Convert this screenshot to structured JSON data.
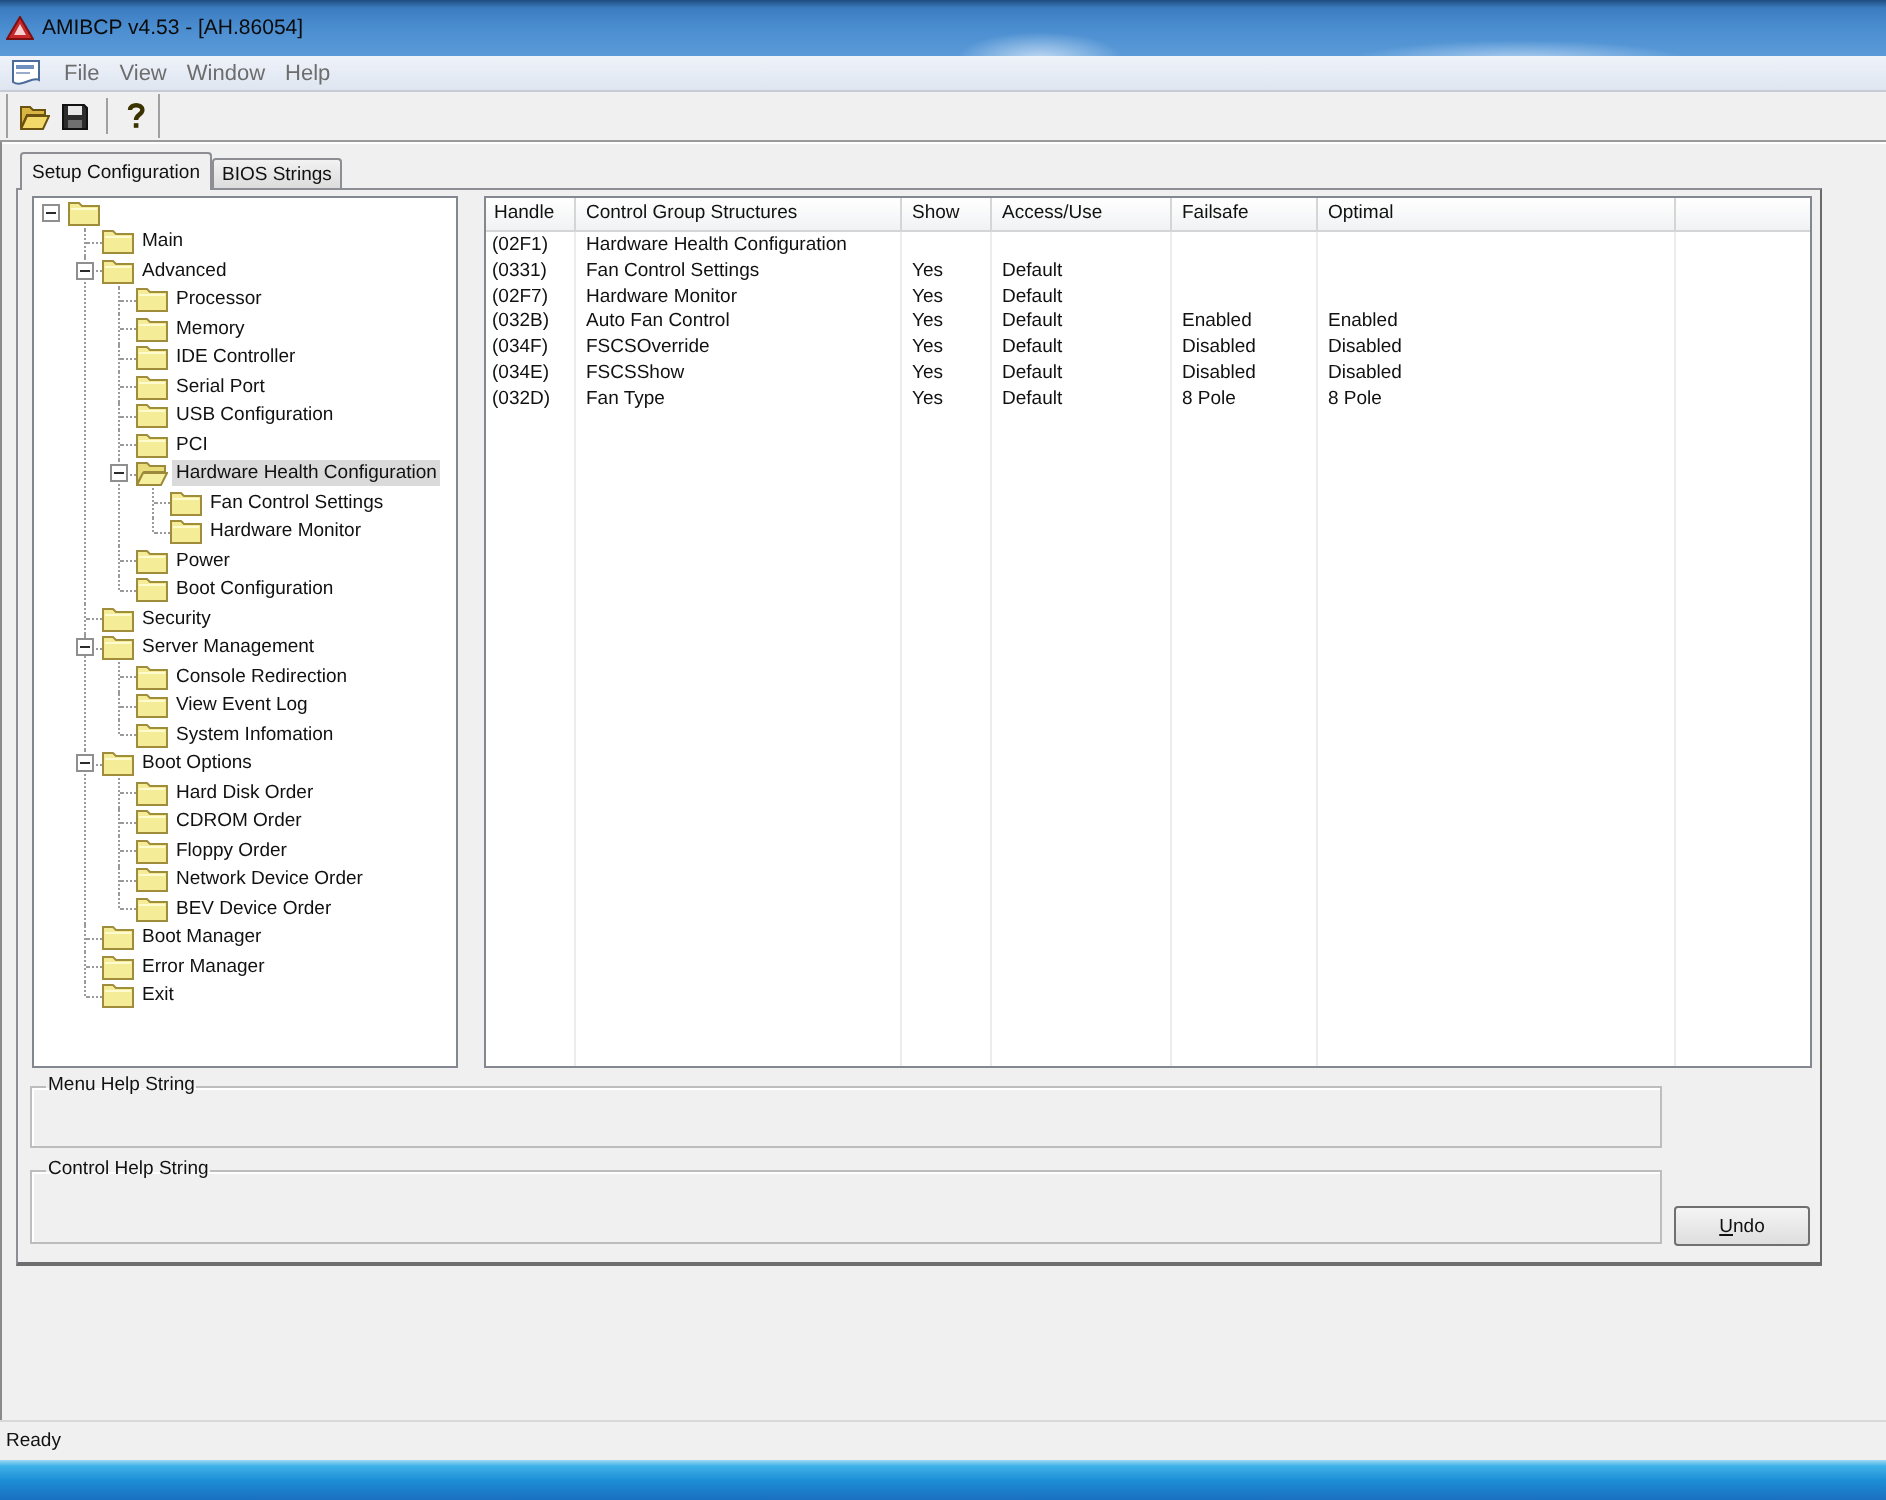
{
  "window": {
    "title": "AMIBCP v4.53 - [AH.86054]"
  },
  "menu_bar": [
    "File",
    "View",
    "Window",
    "Help"
  ],
  "tabs": [
    {
      "label": "Setup Configuration",
      "selected": true
    },
    {
      "label": "BIOS Strings",
      "selected": false
    }
  ],
  "tree": {
    "expanded": true,
    "children": [
      {
        "label": "Main",
        "selected": false
      },
      {
        "label": "Advanced",
        "selected": false,
        "expanded": true,
        "children": [
          {
            "label": "Processor",
            "selected": false
          },
          {
            "label": "Memory",
            "selected": false
          },
          {
            "label": "IDE Controller",
            "selected": false
          },
          {
            "label": "Serial Port",
            "selected": false
          },
          {
            "label": "USB Configuration",
            "selected": false
          },
          {
            "label": "PCI",
            "selected": false
          },
          {
            "label": "Hardware Health Configuration",
            "selected": true,
            "expanded": true,
            "children": [
              {
                "label": "Fan Control Settings",
                "selected": false
              },
              {
                "label": "Hardware Monitor",
                "selected": false
              }
            ]
          },
          {
            "label": "Power",
            "selected": false
          },
          {
            "label": "Boot Configuration",
            "selected": false
          }
        ]
      },
      {
        "label": "Security",
        "selected": false
      },
      {
        "label": "Server Management",
        "selected": false,
        "expanded": true,
        "children": [
          {
            "label": "Console Redirection",
            "selected": false
          },
          {
            "label": "View Event Log",
            "selected": false
          },
          {
            "label": "System Infomation",
            "selected": false
          }
        ]
      },
      {
        "label": "Boot Options",
        "selected": false,
        "expanded": true,
        "children": [
          {
            "label": "Hard Disk Order",
            "selected": false
          },
          {
            "label": "CDROM Order",
            "selected": false
          },
          {
            "label": "Floppy Order",
            "selected": false
          },
          {
            "label": "Network Device Order",
            "selected": false
          },
          {
            "label": "BEV Device Order",
            "selected": false
          }
        ]
      },
      {
        "label": "Boot Manager",
        "selected": false
      },
      {
        "label": "Error Manager",
        "selected": false
      },
      {
        "label": "Exit",
        "selected": false
      }
    ]
  },
  "table": {
    "columns": [
      "Handle",
      "Control Group Structures",
      "Show",
      "Access/Use",
      "Failsafe",
      "Optimal"
    ],
    "rows": [
      {
        "handle": "(02F1)",
        "control_group_structure": "Hardware Health Configuration"
      },
      {
        "handle": "(0331)",
        "control_group_structure": "Fan Control Settings",
        "show": "Yes",
        "access_use": "Default"
      },
      {
        "handle": "(02F7)",
        "control_group_structure": "Hardware Monitor",
        "show": "Yes",
        "access_use": "Default"
      },
      {
        "handle": "(032B)",
        "control_group_structure": "Auto Fan Control",
        "show": "Yes",
        "access_use": "Default",
        "failsafe": "Enabled",
        "optimal": "Enabled"
      },
      {
        "handle": "(034F)",
        "control_group_structure": "FSCSOverride",
        "show": "Yes",
        "access_use": "Default",
        "failsafe": "Disabled",
        "optimal": "Disabled"
      },
      {
        "handle": "(034E)",
        "control_group_structure": "FSCSShow",
        "show": "Yes",
        "access_use": "Default",
        "failsafe": "Disabled",
        "optimal": "Disabled"
      },
      {
        "handle": "(032D)",
        "control_group_structure": "Fan Type",
        "show": "Yes",
        "access_use": "Default",
        "failsafe": "8 Pole",
        "optimal": "8 Pole"
      }
    ]
  },
  "help_strings": [
    {
      "label": "Menu Help String"
    },
    {
      "label": "Control Help String"
    }
  ],
  "undo_button": {
    "label": "Undo"
  },
  "status_bar": {
    "text": "Ready"
  }
}
